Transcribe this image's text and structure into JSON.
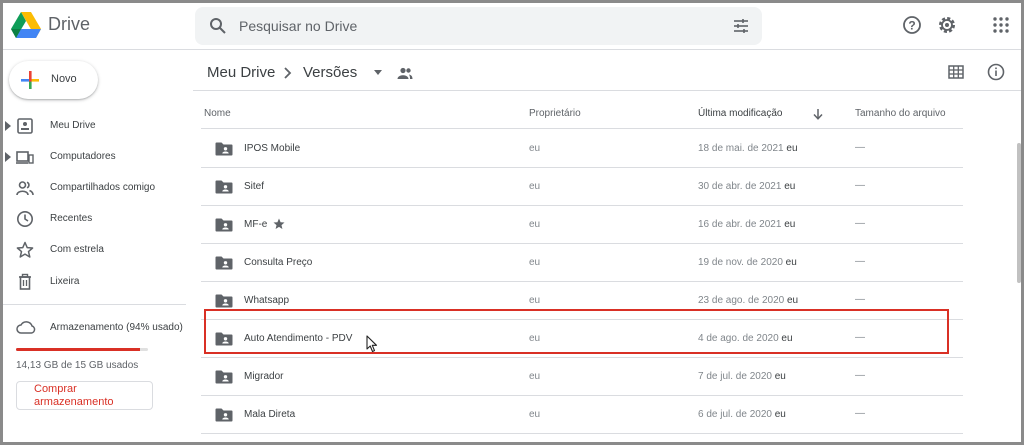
{
  "header": {
    "app_name": "Drive",
    "search_placeholder": "Pesquisar no Drive",
    "icons": [
      "search-icon",
      "filter-icon",
      "help-icon",
      "settings-icon",
      "apps-icon"
    ]
  },
  "sidebar": {
    "new_label": "Novo",
    "items": [
      {
        "label": "Meu Drive",
        "icon": "my-drive-icon",
        "expandable": true
      },
      {
        "label": "Computadores",
        "icon": "computers-icon",
        "expandable": true
      },
      {
        "label": "Compartilhados comigo",
        "icon": "shared-icon",
        "expandable": false
      },
      {
        "label": "Recentes",
        "icon": "clock-icon",
        "expandable": false
      },
      {
        "label": "Com estrela",
        "icon": "star-icon",
        "expandable": false
      },
      {
        "label": "Lixeira",
        "icon": "trash-icon",
        "expandable": false
      }
    ],
    "storage": {
      "label": "Armazenamento (94% usado)",
      "used_fraction": 0.94,
      "usage_text": "14,13 GB de 15 GB usados",
      "buy_label": "Comprar armazenamento"
    }
  },
  "main": {
    "breadcrumb": {
      "root": "Meu Drive",
      "current": "Versões"
    },
    "columns": {
      "name": "Nome",
      "owner": "Proprietário",
      "modified": "Última modificação",
      "size": "Tamanho do arquivo"
    },
    "rows": [
      {
        "name": "IPOS Mobile",
        "starred": false,
        "owner": "eu",
        "modified": "18 de mai. de 2021",
        "modified_by": "eu",
        "size": "—"
      },
      {
        "name": "Sitef",
        "starred": false,
        "owner": "eu",
        "modified": "30 de abr. de 2021",
        "modified_by": "eu",
        "size": "—"
      },
      {
        "name": "MF-e",
        "starred": true,
        "owner": "eu",
        "modified": "16 de abr. de 2021",
        "modified_by": "eu",
        "size": "—"
      },
      {
        "name": "Consulta Preço",
        "starred": false,
        "owner": "eu",
        "modified": "19 de nov. de 2020",
        "modified_by": "eu",
        "size": "—"
      },
      {
        "name": "Whatsapp",
        "starred": false,
        "owner": "eu",
        "modified": "23 de ago. de 2020",
        "modified_by": "eu",
        "size": "—"
      },
      {
        "name": "Auto Atendimento - PDV",
        "starred": false,
        "owner": "eu",
        "modified": "4 de ago. de 2020",
        "modified_by": "eu",
        "size": "—"
      },
      {
        "name": "Migrador",
        "starred": false,
        "owner": "eu",
        "modified": "7 de jul. de 2020",
        "modified_by": "eu",
        "size": "—"
      },
      {
        "name": "Mala Direta",
        "starred": false,
        "owner": "eu",
        "modified": "6 de jul. de 2020",
        "modified_by": "eu",
        "size": "—"
      }
    ],
    "highlighted_row": "Auto Atendimento - PDV"
  },
  "colors": {
    "highlight": "#d93025",
    "storage_bar": "#d93025",
    "icon_gray": "#5f6368",
    "divider": "#dadce0"
  }
}
